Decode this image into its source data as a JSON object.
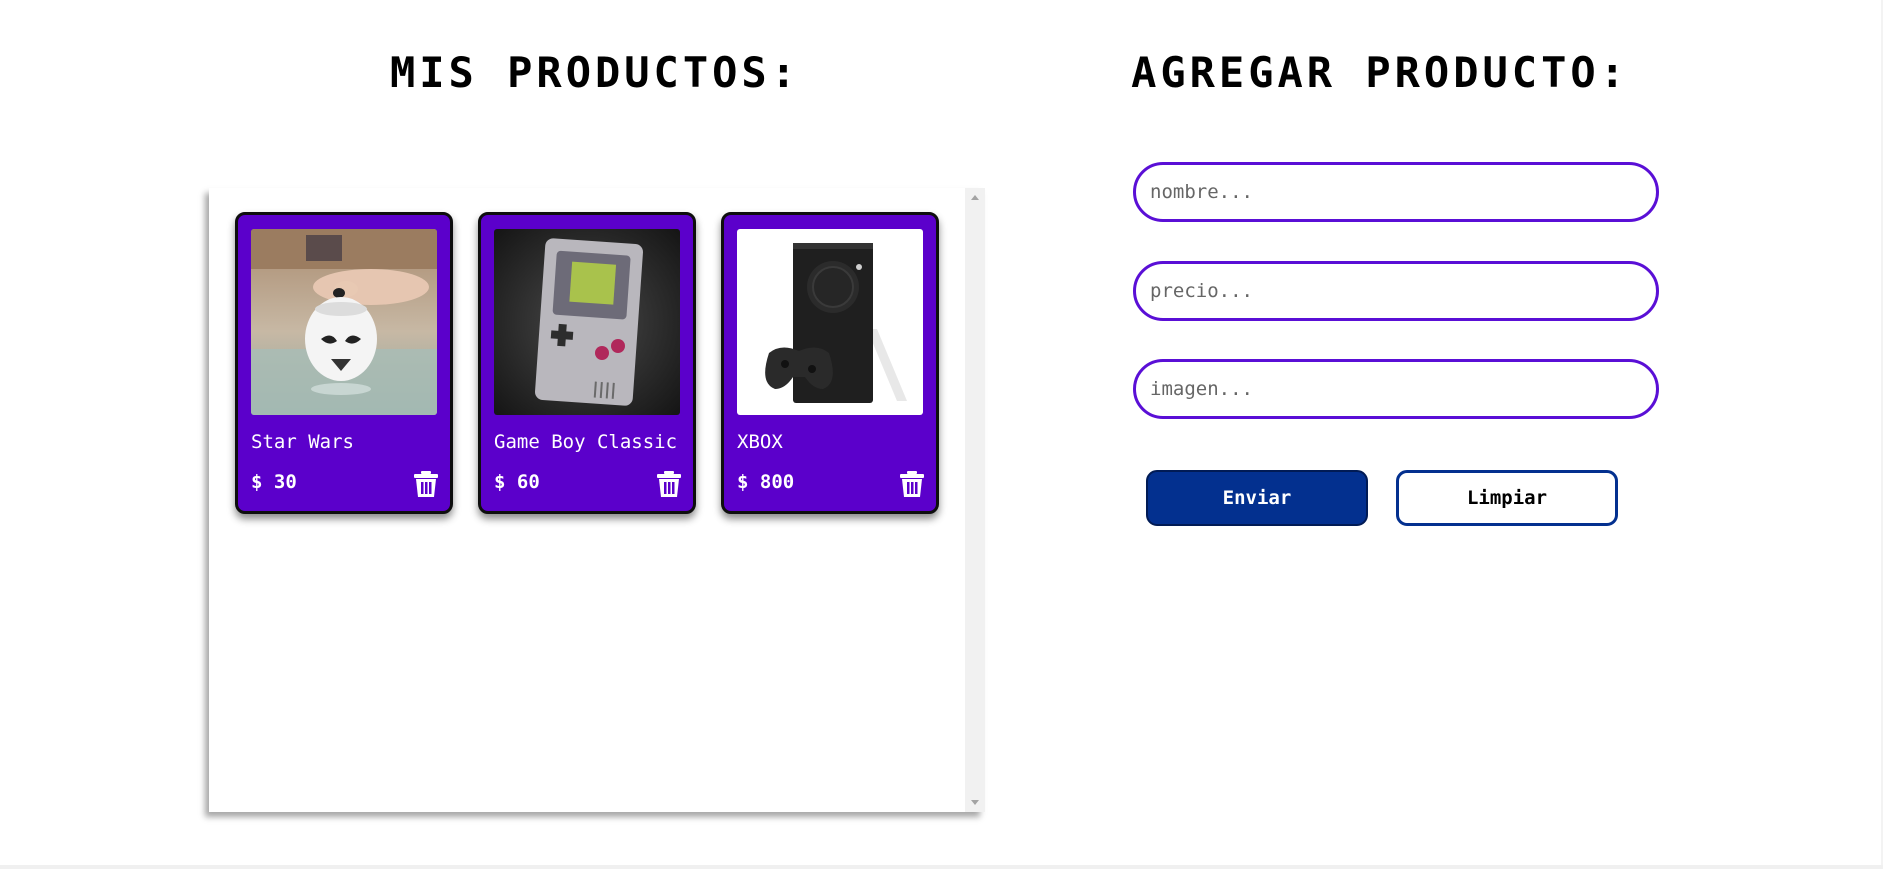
{
  "products_section": {
    "title": "MIS PRODUCTOS:"
  },
  "form_section": {
    "title": "AGREGAR PRODUCTO:"
  },
  "products": [
    {
      "name": "Star Wars",
      "price": "$ 30",
      "image": "stormtrooper-mug-photo"
    },
    {
      "name": "Game Boy Classic",
      "price": "$ 60",
      "image": "game-boy-photo"
    },
    {
      "name": "XBOX",
      "price": "$ 800",
      "image": "xbox-series-s-photo"
    }
  ],
  "form": {
    "name_placeholder": "nombre...",
    "price_placeholder": "precio...",
    "image_placeholder": "imagen...",
    "submit_label": "Enviar",
    "clear_label": "Limpiar"
  },
  "icons": {
    "delete": "trash-icon"
  },
  "colors": {
    "card_background": "#5b00cb",
    "input_border": "#5a0fd6",
    "primary_button": "#03308f"
  }
}
